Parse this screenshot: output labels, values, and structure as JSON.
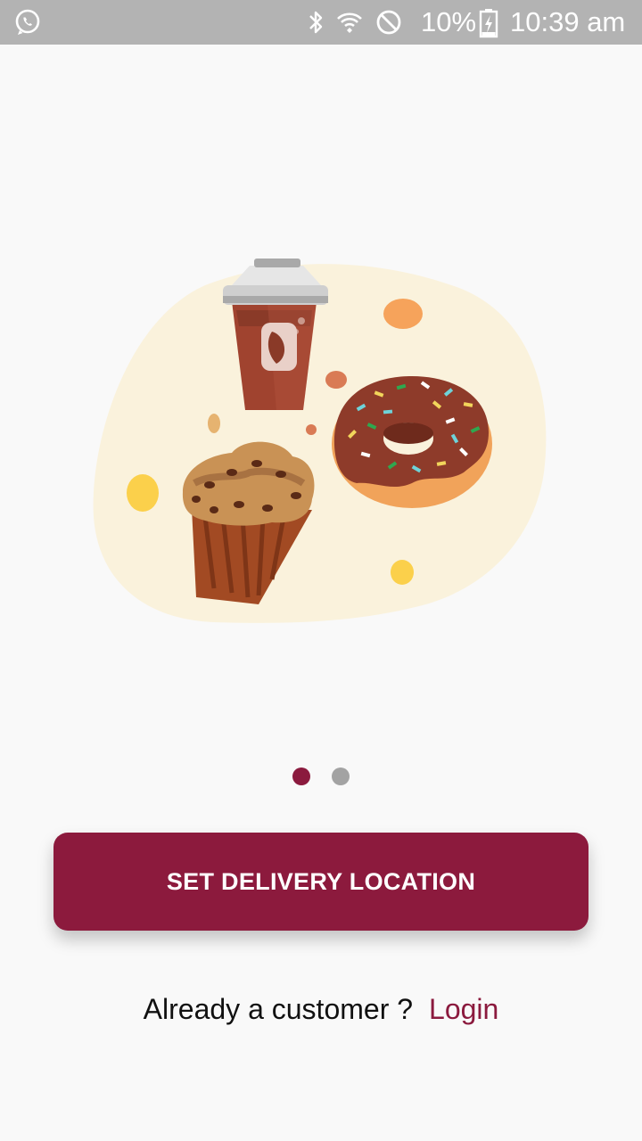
{
  "status_bar": {
    "battery_percent": "10%",
    "time": "10:39 am",
    "icons": [
      "whatsapp-icon",
      "bluetooth-icon",
      "wifi-icon",
      "do-not-disturb-icon",
      "battery-charging-icon"
    ]
  },
  "onboarding": {
    "illustration": "coffee-muffin-donut-illustration",
    "pager": {
      "total_pages": 2,
      "current_page": 1
    }
  },
  "actions": {
    "primary_label": "SET DELIVERY LOCATION",
    "login_prompt": "Already a customer ?",
    "login_label": "Login"
  },
  "colors": {
    "brand": "#8c1a3d",
    "status_bar": "#b3b3b3",
    "background": "#f9f9f9",
    "dot_inactive": "#a3a3a3"
  }
}
